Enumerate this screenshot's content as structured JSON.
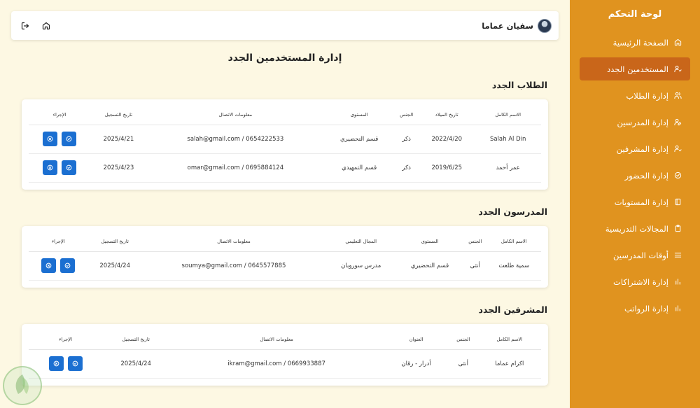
{
  "sidebar": {
    "title": "لوحة التحكم",
    "items": [
      {
        "label": "الصفحة الرئيسية",
        "icon": "home-icon"
      },
      {
        "label": "المستخدمين الجدد",
        "icon": "user-check-icon",
        "active": true
      },
      {
        "label": "إدارة الطلاب",
        "icon": "users-icon"
      },
      {
        "label": "إدارة المدرسين",
        "icon": "user-edit-icon"
      },
      {
        "label": "إدارة المشرفين",
        "icon": "user-check-icon"
      },
      {
        "label": "إدارة الحضور",
        "icon": "check-circle-icon"
      },
      {
        "label": "إدارة المستويات",
        "icon": "book-icon"
      },
      {
        "label": "المجالات التدريسية",
        "icon": "clipboard-icon"
      },
      {
        "label": "أوقات المدرسين",
        "icon": "menu-icon"
      },
      {
        "label": "إدارة الاشتراكات",
        "icon": "bar-chart-icon"
      },
      {
        "label": "إدارة الرواتب",
        "icon": "bar-chart-icon"
      }
    ]
  },
  "header": {
    "user_name": "سفيان عماما",
    "home_icon": "home-icon",
    "logout_icon": "logout-icon"
  },
  "page_title": "إدارة المستخدمين الجدد",
  "students": {
    "title": "الطلاب الجدد",
    "columns": [
      "الاسم الكامل",
      "تاريخ الميلاد",
      "الجنس",
      "المستوى",
      "معلومات الاتصال",
      "تاريخ التسجيل",
      "الإجراء"
    ],
    "rows": [
      [
        "Salah Al Din",
        "2022/4/20",
        "ذكر",
        "قسم التحضيري",
        "salah@gmail.com / 0654222533",
        "2025/4/21"
      ],
      [
        "عمر أحمد",
        "2019/6/25",
        "ذكر",
        "قسم التمهيدي",
        "omar@gmail.com / 0695884124",
        "2025/4/23"
      ]
    ]
  },
  "teachers": {
    "title": "المدرسون الجدد",
    "columns": [
      "الاسم الكامل",
      "الجنس",
      "المستوى",
      "المجال التعليمي",
      "معلومات الاتصال",
      "تاريخ التسجيل",
      "الإجراء"
    ],
    "rows": [
      [
        "سمية طلعت",
        "أنثى",
        "قسم التحضيري",
        "مدرس سوروبان",
        "soumya@gmail.com / 0645577885",
        "2025/4/24"
      ]
    ]
  },
  "supervisors": {
    "title": "المشرفين الجدد",
    "columns": [
      "الاسم الكامل",
      "الجنس",
      "العنوان",
      "معلومات الاتصال",
      "تاريخ التسجيل",
      "الإجراء"
    ],
    "rows": [
      [
        "اكرام عماما",
        "أنثى",
        "أدرار - رقان",
        "ikram@gmail.com / 0669933887",
        "2025/4/24"
      ]
    ]
  },
  "colors": {
    "sidebar": "#e0931f",
    "active": "#c9661a",
    "button": "#1b6fd1",
    "background": "#fdf8e3"
  }
}
